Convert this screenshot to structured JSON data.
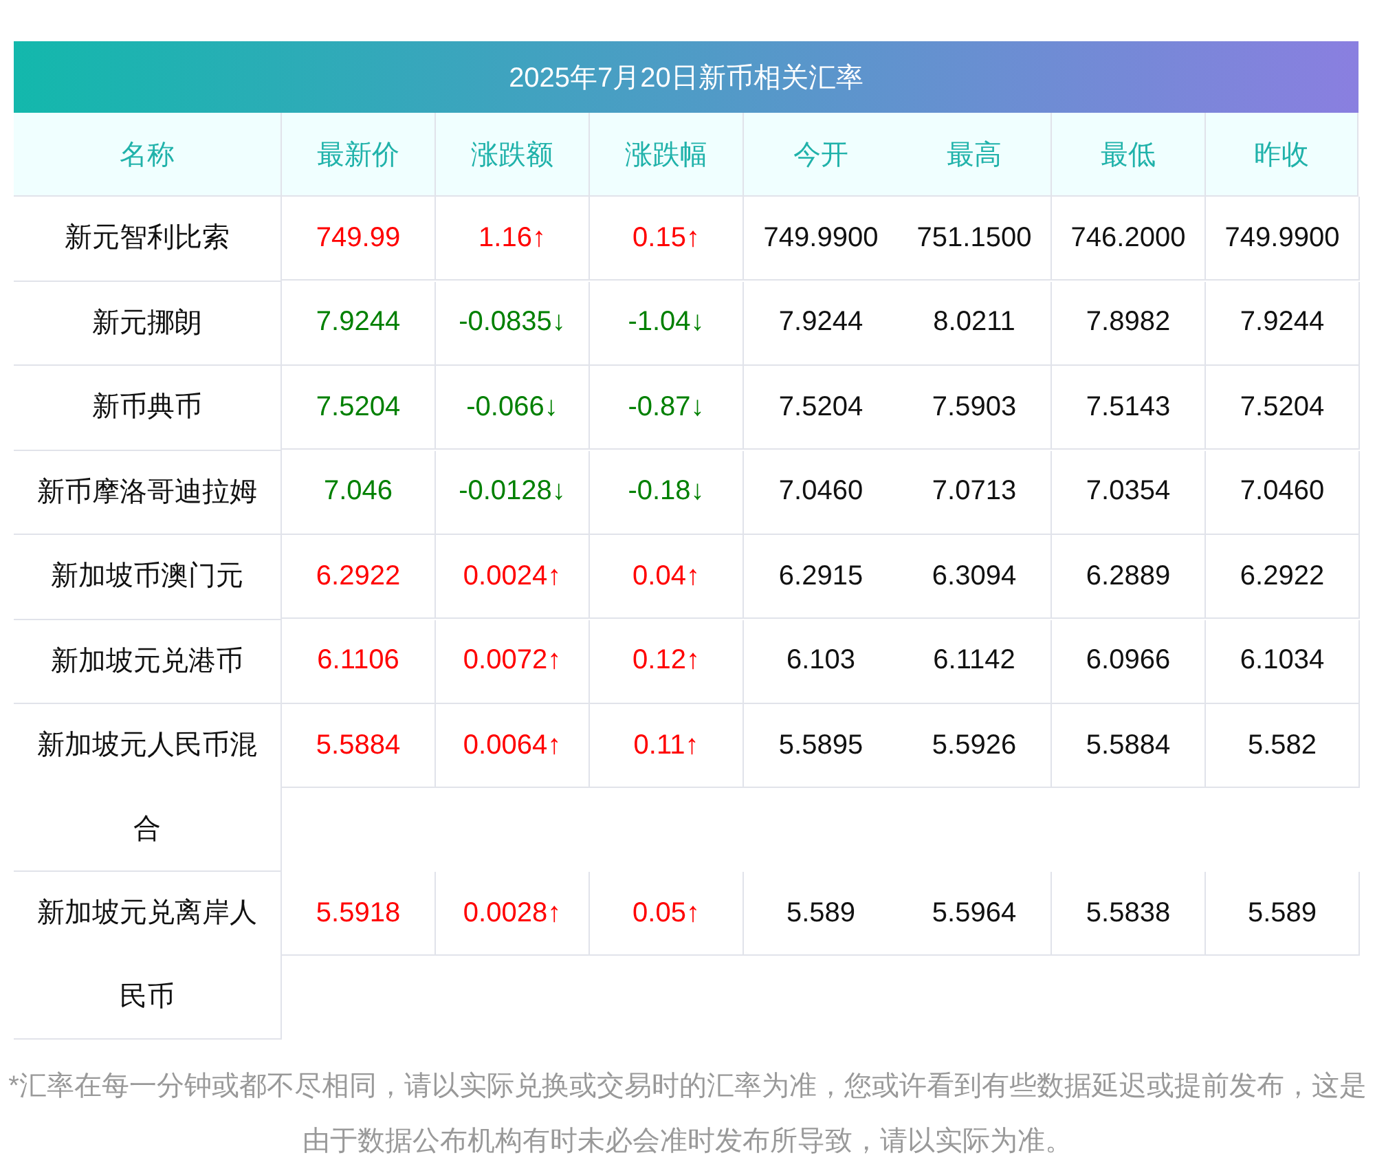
{
  "title": "2025年7月20日新币相关汇率",
  "columns": [
    "名称",
    "最新价",
    "涨跌额",
    "涨跌幅",
    "今开",
    "最高",
    "最低",
    "昨收"
  ],
  "rows": [
    {
      "name": "新元智利比索",
      "rising": true,
      "latest": "749.99",
      "change": "1.16↑",
      "change_pct": "0.15↑",
      "open": "749.9900",
      "high": "751.1500",
      "low": "746.2000",
      "prev_close": "749.9900"
    },
    {
      "name": "新元挪朗",
      "rising": false,
      "latest": "7.9244",
      "change": "-0.0835↓",
      "change_pct": "-1.04↓",
      "open": "7.9244",
      "high": "8.0211",
      "low": "7.8982",
      "prev_close": "7.9244"
    },
    {
      "name": "新币典币",
      "rising": false,
      "latest": "7.5204",
      "change": "-0.066↓",
      "change_pct": "-0.87↓",
      "open": "7.5204",
      "high": "7.5903",
      "low": "7.5143",
      "prev_close": "7.5204"
    },
    {
      "name": "新币摩洛哥迪拉姆",
      "rising": false,
      "latest": "7.046",
      "change": "-0.0128↓",
      "change_pct": "-0.18↓",
      "open": "7.0460",
      "high": "7.0713",
      "low": "7.0354",
      "prev_close": "7.0460"
    },
    {
      "name": "新加坡币澳门元",
      "rising": true,
      "latest": "6.2922",
      "change": "0.0024↑",
      "change_pct": "0.04↑",
      "open": "6.2915",
      "high": "6.3094",
      "low": "6.2889",
      "prev_close": "6.2922"
    },
    {
      "name": "新加坡元兑港币",
      "rising": true,
      "latest": "6.1106",
      "change": "0.0072↑",
      "change_pct": "0.12↑",
      "open": "6.103",
      "high": "6.1142",
      "low": "6.0966",
      "prev_close": "6.1034"
    },
    {
      "name": "新加坡元人民币混合",
      "rising": true,
      "latest": "5.5884",
      "change": "0.0064↑",
      "change_pct": "0.11↑",
      "open": "5.5895",
      "high": "5.5926",
      "low": "5.5884",
      "prev_close": "5.582"
    },
    {
      "name": "新加坡元兑离岸人民币",
      "rising": true,
      "latest": "5.5918",
      "change": "0.0028↑",
      "change_pct": "0.05↑",
      "open": "5.589",
      "high": "5.5964",
      "low": "5.5838",
      "prev_close": "5.589"
    }
  ],
  "note": "*汇率在每一分钟或都不尽相同，请以实际兑换或交易时的汇率为准，您或许看到有些数据延迟或提前发布，这是由于数据公布机构有时未必会准时发布所导致，请以实际为准。"
}
